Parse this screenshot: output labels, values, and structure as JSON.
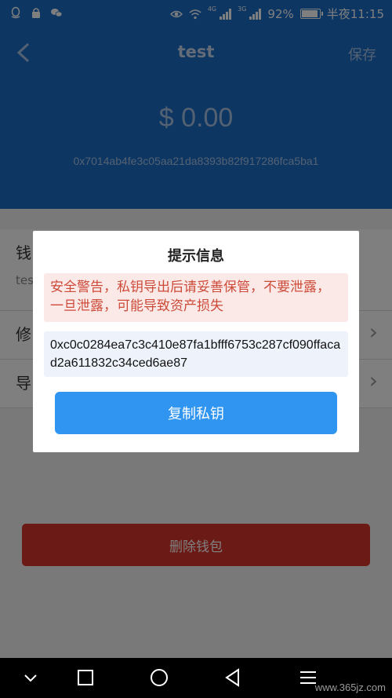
{
  "status_bar": {
    "network_1": "4G",
    "network_2": "3G",
    "battery": "92%",
    "time": "半夜11:15"
  },
  "header": {
    "title": "test",
    "save_label": "保存",
    "balance": "$ 0.00",
    "address": "0x7014ab4fe3c05aa21da8393b82f917286fca5ba1"
  },
  "list": {
    "row1_label": "钱",
    "row1_sub": "tes",
    "row2_label": "修",
    "row3_label": "导"
  },
  "delete_label": "删除钱包",
  "dialog": {
    "title": "提示信息",
    "warning": "安全警告，私钥导出后请妥善保管，不要泄露，一旦泄露，可能导致资产损失",
    "private_key": "0xc0c0284ea7c3c410e87fa1bfff6753c287cf090ffacad2a611832c34ced6ae87",
    "copy_label": "复制私钥"
  },
  "watermark": "www.365jz.com",
  "colors": {
    "header_bg": "#1a6cc7",
    "warning_text": "#cc4b39",
    "warning_bg": "#fbe9e7",
    "key_bg": "#eef3fb",
    "copy_button": "#2f95f0",
    "delete_button": "#d9342b"
  },
  "icons": {
    "back": "chevron-left-icon",
    "chevron": "chevron-right-icon",
    "nav_back": "triangle-back-icon",
    "nav_home": "circle-home-icon",
    "nav_recents": "square-recents-icon",
    "nav_hide": "chevron-down-icon",
    "nav_menu": "menu-icon"
  }
}
